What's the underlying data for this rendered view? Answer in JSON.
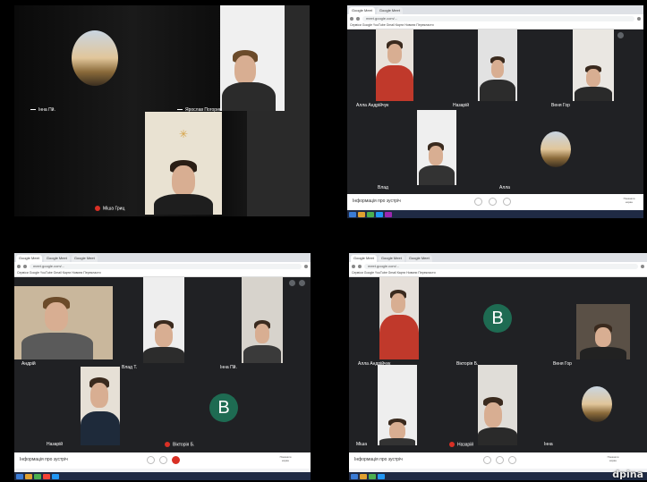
{
  "panel1": {
    "tiles": [
      {
        "name": "Інна Пй."
      },
      {
        "name": "Ярослав Погорин"
      },
      {
        "name": "Міша Гриц"
      }
    ]
  },
  "panel2": {
    "tabs": [
      "Google Meet",
      "Google Meet"
    ],
    "url": "meet.google.com/...",
    "bookmarks": "Сервіси  Google  YouTube  Gmail  Карти  Новини  Перекласти",
    "tiles": [
      {
        "name": "Алла Андрійчук"
      },
      {
        "name": "Назарій"
      },
      {
        "name": "Веня Гор"
      },
      {
        "name": "Влад"
      },
      {
        "name": "Алла"
      }
    ],
    "bottom_left": "Інформація про зустріч",
    "bottom_right": "Показати екран"
  },
  "panel3": {
    "tabs": [
      "Google Meet",
      "Google Meet",
      "Google Meet"
    ],
    "url": "meet.google.com/...",
    "bookmarks": "Сервіси  Google  YouTube  Gmail  Карти  Новини  Перекласти",
    "tiles": [
      {
        "name": "Андрій"
      },
      {
        "name": "Влад Т."
      },
      {
        "name": "Інна Пй."
      },
      {
        "name": "Назарій"
      },
      {
        "name": "Вікторія Б."
      }
    ],
    "avatar_letter": "B",
    "bottom_left": "Інформація про зустріч",
    "bottom_right": "Показати екран"
  },
  "panel4": {
    "tabs": [
      "Google Meet",
      "Google Meet",
      "Google Meet"
    ],
    "url": "meet.google.com/...",
    "bookmarks": "Сервіси  Google  YouTube  Gmail  Карти  Новини  Перекласти",
    "tiles": [
      {
        "name": "Алла Андрійчук"
      },
      {
        "name": "Вікторія Б."
      },
      {
        "name": "Веня Гор"
      },
      {
        "name": "Міша"
      },
      {
        "name": "Назарій"
      },
      {
        "name": "Інна"
      }
    ],
    "avatar_letter": "B",
    "bottom_left": "Інформація про зустріч",
    "bottom_right": "Показати екран"
  },
  "watermark": "dpina",
  "colors": {
    "meet_bg": "#202124",
    "avatar_green": "#1e6b52",
    "leave_red": "#d93025"
  }
}
